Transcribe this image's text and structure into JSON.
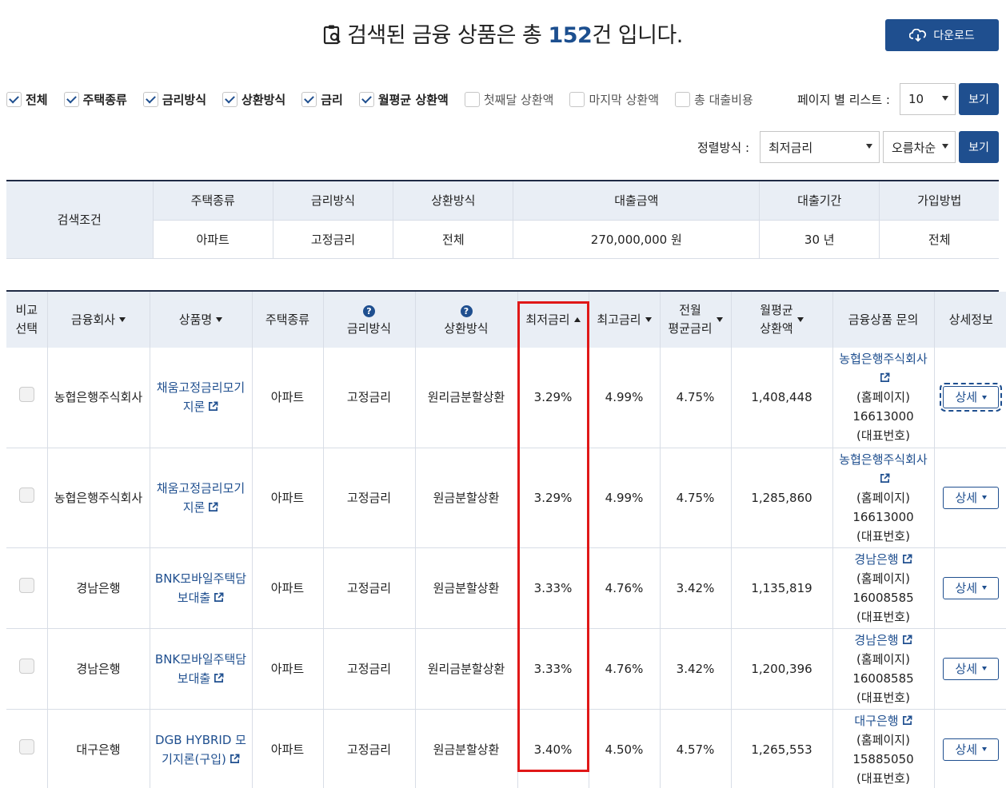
{
  "title": {
    "prefix": "검색된 금융 상품은 총 ",
    "count": "152",
    "suffix": "건 입니다."
  },
  "download_label": "다운로드",
  "filters": [
    {
      "label": "전체",
      "checked": true
    },
    {
      "label": "주택종류",
      "checked": true
    },
    {
      "label": "금리방식",
      "checked": true
    },
    {
      "label": "상환방식",
      "checked": true
    },
    {
      "label": "금리",
      "checked": true
    },
    {
      "label": "월평균 상환액",
      "checked": true
    },
    {
      "label": "첫째달 상환액",
      "checked": false
    },
    {
      "label": "마지막 상환액",
      "checked": false
    },
    {
      "label": "총 대출비용",
      "checked": false
    }
  ],
  "page_list": {
    "label": "페이지 별 리스트 :",
    "value": "10",
    "view": "보기"
  },
  "sort": {
    "label": "정렬방식 :",
    "field": "최저금리",
    "order": "오름차순",
    "view": "보기"
  },
  "conditions": {
    "label": "검색조건",
    "headers": [
      "주택종류",
      "금리방식",
      "상환방식",
      "대출금액",
      "대출기간",
      "가입방법"
    ],
    "values": [
      "아파트",
      "고정금리",
      "전체",
      "270,000,000 원",
      "30 년",
      "전체"
    ]
  },
  "table": {
    "headers": {
      "compare": "비교\n선택",
      "company": "금융회사",
      "product": "상품명",
      "house": "주택종류",
      "rate_type": "금리방식",
      "repay": "상환방식",
      "min_rate": "최저금리",
      "max_rate": "최고금리",
      "avg_rate": "전월\n평균금리",
      "monthly": "월평균\n상환액",
      "contact": "금융상품 문의",
      "detail": "상세정보"
    },
    "rows": [
      {
        "company": "농협은행주식회사",
        "product": "채움고정금리모기지론",
        "house": "아파트",
        "rate_type": "고정금리",
        "repay": "원리금분할상환",
        "min_rate": "3.29%",
        "max_rate": "4.99%",
        "avg_rate": "4.75%",
        "monthly": "1,408,448",
        "contact_name": "농협은행주식회사",
        "homepage": "(홈페이지)",
        "phone": "16613000",
        "phone_label": "(대표번호)",
        "detail": "상세"
      },
      {
        "company": "농협은행주식회사",
        "product": "채움고정금리모기지론",
        "house": "아파트",
        "rate_type": "고정금리",
        "repay": "원금분할상환",
        "min_rate": "3.29%",
        "max_rate": "4.99%",
        "avg_rate": "4.75%",
        "monthly": "1,285,860",
        "contact_name": "농협은행주식회사",
        "homepage": "(홈페이지)",
        "phone": "16613000",
        "phone_label": "(대표번호)",
        "detail": "상세"
      },
      {
        "company": "경남은행",
        "product": "BNK모바일주택담보대출",
        "house": "아파트",
        "rate_type": "고정금리",
        "repay": "원금분할상환",
        "min_rate": "3.33%",
        "max_rate": "4.76%",
        "avg_rate": "3.42%",
        "monthly": "1,135,819",
        "contact_name": "경남은행",
        "homepage": "(홈페이지)",
        "phone": "16008585",
        "phone_label": "(대표번호)",
        "detail": "상세"
      },
      {
        "company": "경남은행",
        "product": "BNK모바일주택담보대출",
        "house": "아파트",
        "rate_type": "고정금리",
        "repay": "원리금분할상환",
        "min_rate": "3.33%",
        "max_rate": "4.76%",
        "avg_rate": "3.42%",
        "monthly": "1,200,396",
        "contact_name": "경남은행",
        "homepage": "(홈페이지)",
        "phone": "16008585",
        "phone_label": "(대표번호)",
        "detail": "상세"
      },
      {
        "company": "대구은행",
        "product": "DGB HYBRID 모기지론(구입)",
        "house": "아파트",
        "rate_type": "고정금리",
        "repay": "원금분할상환",
        "min_rate": "3.40%",
        "max_rate": "4.50%",
        "avg_rate": "4.57%",
        "monthly": "1,265,553",
        "contact_name": "대구은행",
        "homepage": "(홈페이지)",
        "phone": "15885050",
        "phone_label": "(대표번호)",
        "detail": "상세"
      }
    ]
  }
}
